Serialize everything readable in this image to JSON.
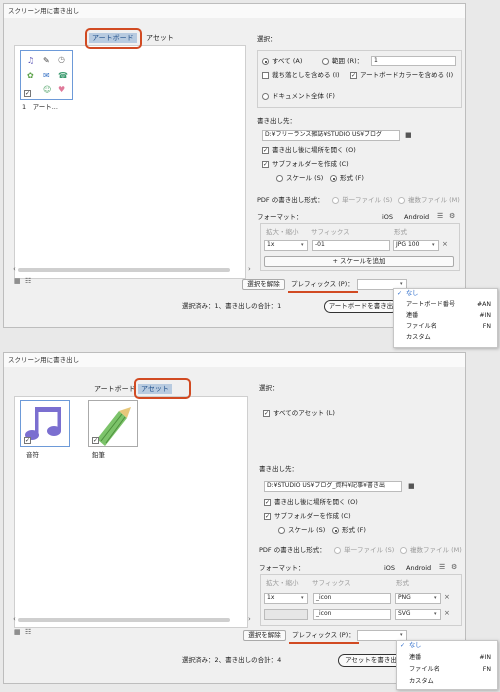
{
  "top": {
    "title": "スクリーン用に書き出し",
    "tabs": [
      "アートボード",
      "アセット"
    ],
    "artboard_label": "1　アート...",
    "selection": {
      "heading": "選択：",
      "all": "すべて (A)",
      "range": "範囲 (R)：",
      "range_value": "1",
      "bleed": "裁ち落としを含める (I)",
      "artboard_color": "アートボードカラーを含める (I)",
      "whole_doc": "ドキュメント全体 (F)"
    },
    "export_to": {
      "heading": "書き出し先：",
      "path": "D:¥フリーランス雑誌¥STUDIO US¥ブログ",
      "open_location": "書き出し後に場所を開く (O)",
      "subfolders": "サブフォルダーを作成 (C)",
      "scale": "スケール (S)",
      "format": "形式 (F)"
    },
    "pdf": {
      "label": "PDF の書き出し形式：",
      "single": "単一ファイル (S)",
      "multiple": "複数ファイル (M)"
    },
    "formats": {
      "label": "フォーマット：",
      "ios": "iOS",
      "android": "Android",
      "col_scale": "拡大・縮小",
      "col_suffix": "サフィックス",
      "col_format": "形式",
      "row1": {
        "scale": "1x",
        "suffix": "-01",
        "format": "JPG 100"
      },
      "add_scale": "スケールを追加"
    },
    "clear_selection": "選択を解除",
    "prefix": "プレフィックス (P)：",
    "status": "選択済み：1、書き出しの合計：1",
    "export_button": "アートボードを書き出",
    "menu": [
      {
        "label": "なし",
        "shortcut": "",
        "checked": true
      },
      {
        "label": "アートボード番号",
        "shortcut": "#AN",
        "checked": false
      },
      {
        "label": "連番",
        "shortcut": "#IN",
        "checked": false
      },
      {
        "label": "ファイル名",
        "shortcut": "FN",
        "checked": false
      },
      {
        "label": "カスタム",
        "shortcut": "",
        "checked": false
      }
    ]
  },
  "bottom": {
    "title": "スクリーン用に書き出し",
    "tabs": [
      "アートボード",
      "アセット"
    ],
    "asset1_label": "音符",
    "asset2_label": "鉛筆",
    "selection": {
      "heading": "選択：",
      "all_assets": "すべてのアセット (L)"
    },
    "export_to": {
      "heading": "書き出し先：",
      "path": "D:¥STUDIO US¥ブログ_資料¥記事¥書き出",
      "open_location": "書き出し後に場所を開く (O)",
      "subfolders": "サブフォルダーを作成 (C)",
      "scale": "スケール (S)",
      "format": "形式 (F)"
    },
    "pdf": {
      "label": "PDF の書き出し形式：",
      "single": "単一ファイル (S)",
      "multiple": "複数ファイル (M)"
    },
    "formats": {
      "label": "フォーマット：",
      "ios": "iOS",
      "android": "Android",
      "col_scale": "拡大・縮小",
      "col_suffix": "サフィックス",
      "col_format": "形式",
      "row1": {
        "scale": "1x",
        "suffix": "_icon",
        "format": "PNG"
      },
      "row2": {
        "suffix": "_icon",
        "format": "SVG"
      }
    },
    "clear_selection": "選択を解除",
    "prefix": "プレフィックス (P)：",
    "status": "選択済み：2、書き出しの合計：4",
    "export_button": "アセットを書き出",
    "menu": [
      {
        "label": "なし",
        "shortcut": "",
        "checked": true
      },
      {
        "label": "連番",
        "shortcut": "#IN",
        "checked": false
      },
      {
        "label": "ファイル名",
        "shortcut": "FN",
        "checked": false
      },
      {
        "label": "カスタム",
        "shortcut": "",
        "checked": false
      }
    ]
  },
  "colors": {
    "accent": "#d14a22",
    "tab_selected": "#b8cbe0",
    "link_blue": "#2466c8"
  }
}
